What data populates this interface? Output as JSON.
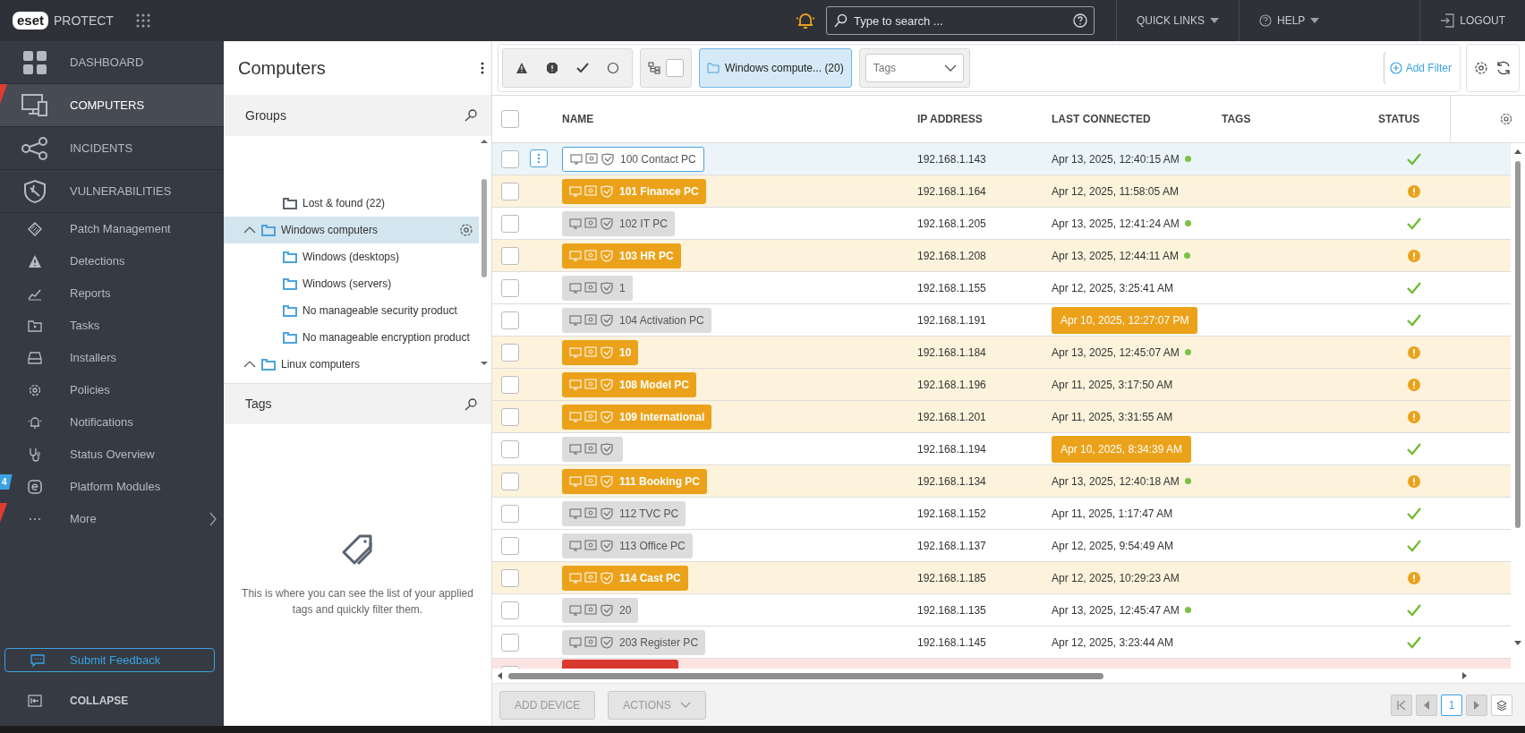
{
  "topbar": {
    "logo": "eset",
    "product": "PROTECT",
    "search_placeholder": "Type to search ...",
    "quick_links": "QUICK LINKS",
    "help": "HELP",
    "logout": "LOGOUT"
  },
  "sidebar": {
    "items": [
      {
        "label": "DASHBOARD",
        "kind": "main",
        "selected": false
      },
      {
        "label": "COMPUTERS",
        "kind": "main",
        "selected": true,
        "flagged": true
      },
      {
        "label": "INCIDENTS",
        "kind": "main",
        "selected": false
      },
      {
        "label": "VULNERABILITIES",
        "kind": "main",
        "selected": false
      },
      {
        "label": "Patch Management",
        "kind": "sub",
        "selected": false
      },
      {
        "label": "Detections",
        "kind": "sub",
        "selected": false
      },
      {
        "label": "Reports",
        "kind": "sub",
        "selected": false
      },
      {
        "label": "Tasks",
        "kind": "sub",
        "selected": false
      },
      {
        "label": "Installers",
        "kind": "sub",
        "selected": false
      },
      {
        "label": "Policies",
        "kind": "sub",
        "selected": false
      },
      {
        "label": "Notifications",
        "kind": "sub",
        "selected": false
      },
      {
        "label": "Status Overview",
        "kind": "sub",
        "selected": false
      },
      {
        "label": "Platform Modules",
        "kind": "sub",
        "selected": false,
        "count": "4"
      },
      {
        "label": "More",
        "kind": "more",
        "selected": false,
        "flagged": true
      }
    ],
    "feedback": "Submit Feedback",
    "collapse": "COLLAPSE"
  },
  "groups_panel": {
    "title": "Computers",
    "groups_title": "Groups",
    "tags_title": "Tags",
    "tags_empty": "This is where you can see the list of your applied tags and quickly filter them.",
    "tree": [
      {
        "label": "Lost & found (22)",
        "selected": false,
        "color": "#5a6370"
      },
      {
        "label": "Windows computers",
        "selected": true,
        "expanded": true,
        "color": "#4aa3df",
        "children": [
          {
            "label": "Windows (desktops)",
            "selected": false,
            "color": "#4aa3df"
          },
          {
            "label": "Windows (servers)",
            "selected": false,
            "color": "#4aa3df"
          },
          {
            "label": "No manageable security product",
            "selected": false,
            "color": "#4aa3df"
          },
          {
            "label": "No manageable encryption product",
            "selected": false,
            "color": "#4aa3df"
          }
        ]
      },
      {
        "label": "Linux computers",
        "selected": false,
        "expanded": true,
        "color": "#4aa3df"
      }
    ]
  },
  "filter_bar": {
    "subgroups_checked": false,
    "group_filter": "Windows compute... (20)",
    "tags_placeholder": "Tags",
    "add_filter": "Add Filter"
  },
  "table": {
    "select_all_checked": false,
    "columns": [
      "NAME",
      "IP ADDRESS",
      "LAST CONNECTED",
      "TAGS",
      "STATUS"
    ],
    "rows": [
      {
        "name": "100 Contact PC",
        "ip": "192.168.1.143",
        "last_connected": "Apr 13, 2025, 12:40:15 AM",
        "online": true,
        "overdue": false,
        "kind": "ok",
        "selected": true,
        "checked": false
      },
      {
        "name": "101 Finance PC",
        "ip": "192.168.1.164",
        "last_connected": "Apr 12, 2025, 11:58:05 AM",
        "online": false,
        "overdue": false,
        "kind": "warning",
        "selected": false,
        "checked": false
      },
      {
        "name": "102 IT PC",
        "ip": "192.168.1.205",
        "last_connected": "Apr 13, 2025, 12:41:24 AM",
        "online": true,
        "overdue": false,
        "kind": "ok",
        "selected": false,
        "checked": false
      },
      {
        "name": "103 HR PC",
        "ip": "192.168.1.208",
        "last_connected": "Apr 13, 2025, 12:44:11 AM",
        "online": true,
        "overdue": false,
        "kind": "warning",
        "selected": false,
        "checked": false
      },
      {
        "name": "1",
        "ip": "192.168.1.155",
        "last_connected": "Apr 12, 2025, 3:25:41 AM",
        "online": false,
        "overdue": false,
        "kind": "ok",
        "selected": false,
        "checked": false
      },
      {
        "name": "104 Activation PC",
        "ip": "192.168.1.191",
        "last_connected": "Apr 10, 2025, 12:27:07 PM",
        "online": false,
        "overdue": true,
        "kind": "ok",
        "selected": false,
        "checked": false
      },
      {
        "name": "10",
        "ip": "192.168.1.184",
        "last_connected": "Apr 13, 2025, 12:45:07 AM",
        "online": true,
        "overdue": false,
        "kind": "warning",
        "selected": false,
        "checked": false
      },
      {
        "name": "108 Model PC",
        "ip": "192.168.1.196",
        "last_connected": "Apr 11, 2025, 3:17:50 AM",
        "online": false,
        "overdue": false,
        "kind": "warning",
        "selected": false,
        "checked": false
      },
      {
        "name": "109 International",
        "ip": "192.168.1.201",
        "last_connected": "Apr 11, 2025, 3:31:55 AM",
        "online": false,
        "overdue": false,
        "kind": "warning",
        "selected": false,
        "checked": false
      },
      {
        "ip": "192.168.1.194",
        "last_connected": "Apr 10, 2025, 8:34:39 AM",
        "online": false,
        "overdue": true,
        "kind": "ok",
        "selected": false,
        "checked": false
      },
      {
        "name": "111 Booking PC",
        "ip": "192.168.1.134",
        "last_connected": "Apr 13, 2025, 12:40:18 AM",
        "online": true,
        "overdue": false,
        "kind": "warning",
        "selected": false,
        "checked": false
      },
      {
        "name": "112 TVC PC",
        "ip": "192.168.1.152",
        "last_connected": "Apr 11, 2025, 1:17:47 AM",
        "online": false,
        "overdue": false,
        "kind": "ok",
        "selected": false,
        "checked": false
      },
      {
        "name": "113 Office PC",
        "ip": "192.168.1.137",
        "last_connected": "Apr 12, 2025, 9:54:49 AM",
        "online": false,
        "overdue": false,
        "kind": "ok",
        "selected": false,
        "checked": false
      },
      {
        "name": "114 Cast PC",
        "ip": "192.168.1.185",
        "last_connected": "Apr 12, 2025, 10:29:23 AM",
        "online": false,
        "overdue": false,
        "kind": "warning",
        "selected": false,
        "checked": false
      },
      {
        "name": "20",
        "ip": "192.168.1.135",
        "last_connected": "Apr 13, 2025, 12:45:47 AM",
        "online": true,
        "overdue": false,
        "kind": "ok",
        "selected": false,
        "checked": false
      },
      {
        "name": "203 Register PC",
        "ip": "192.168.1.145",
        "last_connected": "Apr 12, 2025, 3:23:44 AM",
        "online": false,
        "overdue": false,
        "kind": "ok",
        "selected": false,
        "checked": false
      },
      {
        "kind": "error",
        "selected": false
      }
    ]
  },
  "footer": {
    "add_device": "ADD DEVICE",
    "actions": "ACTIONS",
    "page": "1"
  }
}
